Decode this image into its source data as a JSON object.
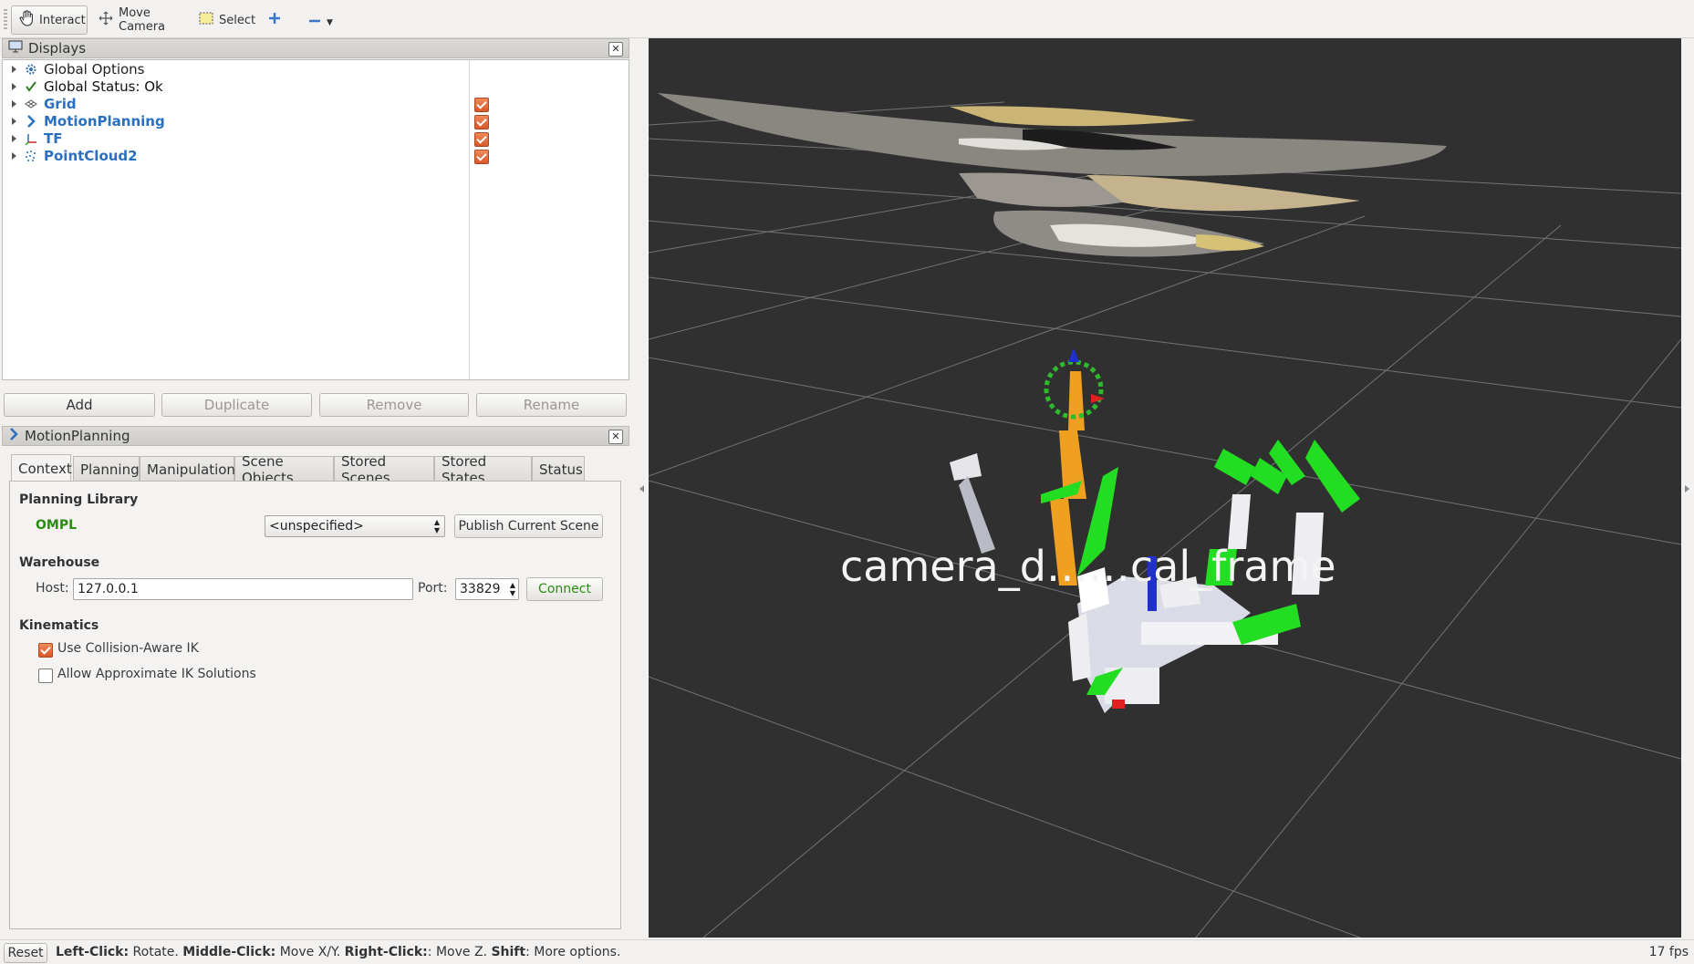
{
  "toolbar": {
    "interact": "Interact",
    "move_camera": "Move Camera",
    "select": "Select"
  },
  "displays_panel": {
    "title": "Displays",
    "items": [
      {
        "label": "Global Options",
        "icon": "gear-icon",
        "checked": null
      },
      {
        "label": "Global Status: Ok",
        "icon": "checkmark-icon",
        "checked": null
      },
      {
        "label": "Grid",
        "icon": "grid-icon",
        "checked": true
      },
      {
        "label": "MotionPlanning",
        "icon": "motion-planning-icon",
        "checked": true
      },
      {
        "label": "TF",
        "icon": "tf-axes-icon",
        "checked": true
      },
      {
        "label": "PointCloud2",
        "icon": "point-cloud-icon",
        "checked": true
      }
    ],
    "buttons": {
      "add": "Add",
      "duplicate": "Duplicate",
      "remove": "Remove",
      "rename": "Rename"
    }
  },
  "motion_panel": {
    "title": "MotionPlanning",
    "tabs": [
      "Context",
      "Planning",
      "Manipulation",
      "Scene Objects",
      "Stored Scenes",
      "Stored States",
      "Status"
    ],
    "active_tab": "Context",
    "planning_library": {
      "heading": "Planning Library",
      "library": "OMPL",
      "planner": "<unspecified>",
      "publish_button": "Publish Current Scene"
    },
    "warehouse": {
      "heading": "Warehouse",
      "host_label": "Host:",
      "host_value": "127.0.0.1",
      "port_label": "Port:",
      "port_value": "33829",
      "connect_button": "Connect"
    },
    "kinematics": {
      "heading": "Kinematics",
      "collision_aware_label": "Use Collision-Aware IK",
      "collision_aware_checked": true,
      "approximate_label": "Allow Approximate IK Solutions",
      "approximate_checked": false
    }
  },
  "viewport": {
    "frame_label": "camera_d……cal_frame",
    "background": "#303030"
  },
  "statusbar": {
    "reset": "Reset",
    "hint_left_click_key": "Left-Click:",
    "hint_left_click": " Rotate. ",
    "hint_middle_click_key": "Middle-Click:",
    "hint_middle_click": " Move X/Y. ",
    "hint_right_click_key": "Right-Click:",
    "hint_right_click": ": Move Z. ",
    "hint_shift_key": "Shift",
    "hint_shift": ": More options.",
    "fps": "17 fps"
  },
  "colors": {
    "link_blue": "#2b6fbf",
    "ompl_green": "#2a8a14",
    "checkbox_orange": "#e0622f",
    "gripper_green": "#22dd22",
    "arm_orange": "#f0a020"
  }
}
